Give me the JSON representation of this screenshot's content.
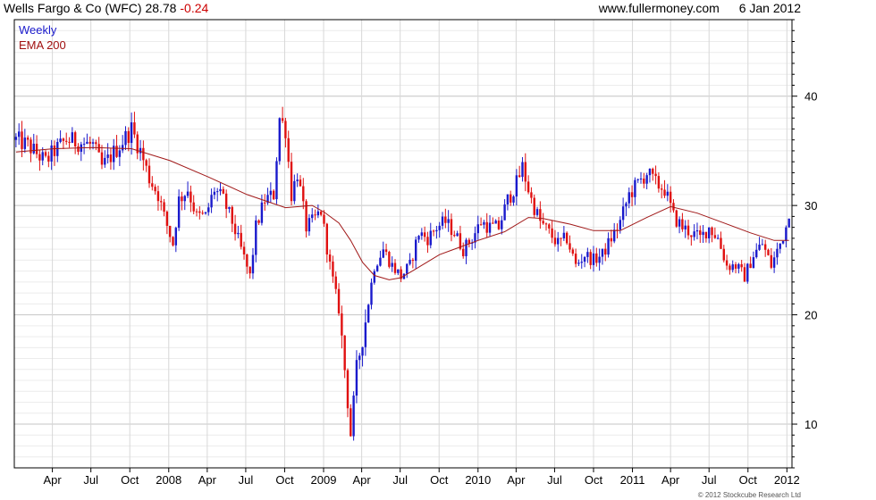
{
  "header": {
    "title": "Wells Fargo & Co (WFC)",
    "last": "28.78",
    "change": "-0.24",
    "site": "www.fullermoney.com",
    "date": "6 Jan 2012"
  },
  "legend": {
    "weekly": "Weekly",
    "ema": "EMA 200"
  },
  "credit": "© 2012 Stockcube Research Ltd",
  "colors": {
    "up": "#1a1acc",
    "down": "#e01010",
    "ema": "#a01818",
    "grid": "#d4d4d4"
  },
  "chart_data": {
    "type": "line",
    "title": "Wells Fargo & Co (WFC)",
    "xlabel": "",
    "ylabel": "",
    "ylim": [
      6,
      47
    ],
    "yticks": [
      "10",
      "20",
      "30",
      "40"
    ],
    "ytick_values": [
      10,
      20,
      30,
      40
    ],
    "xticks": [
      "Apr",
      "Jul",
      "Oct",
      "2008",
      "Apr",
      "Jul",
      "Oct",
      "2009",
      "Apr",
      "Jul",
      "Oct",
      "2010",
      "Apr",
      "Jul",
      "Oct",
      "2011",
      "Apr",
      "Jul",
      "Oct",
      "2012"
    ],
    "xtick_dates": [
      "2007-04-01",
      "2007-07-01",
      "2007-10-01",
      "2008-01-01",
      "2008-04-01",
      "2008-07-01",
      "2008-10-01",
      "2009-01-01",
      "2009-04-01",
      "2009-07-01",
      "2009-10-01",
      "2010-01-01",
      "2010-04-01",
      "2010-07-01",
      "2010-10-01",
      "2011-01-01",
      "2011-04-01",
      "2011-07-01",
      "2011-10-01",
      "2012-01-01"
    ],
    "x_range": [
      "2007-01-01",
      "2012-01-13"
    ],
    "grid": true,
    "legend_position": "top-left",
    "series": [
      {
        "name": "Weekly",
        "kind": "price",
        "points": [
          [
            "2007-01-05",
            36.0
          ],
          [
            "2007-02-02",
            35.5
          ],
          [
            "2007-03-02",
            34.5
          ],
          [
            "2007-03-16",
            34.0
          ],
          [
            "2007-04-06",
            35.0
          ],
          [
            "2007-05-04",
            36.0
          ],
          [
            "2007-06-01",
            35.8
          ],
          [
            "2007-07-06",
            35.5
          ],
          [
            "2007-07-27",
            33.5
          ],
          [
            "2007-08-17",
            34.5
          ],
          [
            "2007-09-07",
            35.5
          ],
          [
            "2007-10-05",
            37.0
          ],
          [
            "2007-10-26",
            35.0
          ],
          [
            "2007-11-16",
            32.5
          ],
          [
            "2007-12-07",
            31.0
          ],
          [
            "2007-12-21",
            29.0
          ],
          [
            "2008-01-11",
            26.5
          ],
          [
            "2008-01-25",
            30.5
          ],
          [
            "2008-02-15",
            31.5
          ],
          [
            "2008-03-07",
            29.0
          ],
          [
            "2008-03-28",
            29.0
          ],
          [
            "2008-04-18",
            31.5
          ],
          [
            "2008-05-09",
            30.5
          ],
          [
            "2008-05-30",
            28.5
          ],
          [
            "2008-06-20",
            26.0
          ],
          [
            "2008-07-11",
            23.5
          ],
          [
            "2008-07-25",
            28.0
          ],
          [
            "2008-08-15",
            30.5
          ],
          [
            "2008-09-05",
            31.0
          ],
          [
            "2008-09-19",
            38.0
          ],
          [
            "2008-10-03",
            37.0
          ],
          [
            "2008-10-17",
            31.0
          ],
          [
            "2008-10-31",
            33.0
          ],
          [
            "2008-11-21",
            28.0
          ],
          [
            "2008-12-05",
            28.5
          ],
          [
            "2008-12-26",
            29.5
          ],
          [
            "2009-01-16",
            24.5
          ],
          [
            "2009-02-06",
            20.5
          ],
          [
            "2009-02-20",
            15.0
          ],
          [
            "2009-03-06",
            9.0
          ],
          [
            "2009-03-20",
            15.0
          ],
          [
            "2009-04-10",
            19.5
          ],
          [
            "2009-05-01",
            24.5
          ],
          [
            "2009-05-22",
            26.0
          ],
          [
            "2009-06-12",
            24.5
          ],
          [
            "2009-07-03",
            23.5
          ],
          [
            "2009-07-24",
            24.5
          ],
          [
            "2009-08-14",
            27.5
          ],
          [
            "2009-09-04",
            27.0
          ],
          [
            "2009-09-25",
            28.0
          ],
          [
            "2009-10-16",
            28.5
          ],
          [
            "2009-11-06",
            27.5
          ],
          [
            "2009-11-27",
            26.0
          ],
          [
            "2009-12-18",
            27.0
          ],
          [
            "2010-01-08",
            28.5
          ],
          [
            "2010-01-29",
            28.0
          ],
          [
            "2010-02-19",
            28.0
          ],
          [
            "2010-03-12",
            30.5
          ],
          [
            "2010-04-02",
            32.0
          ],
          [
            "2010-04-16",
            33.5
          ],
          [
            "2010-05-07",
            30.5
          ],
          [
            "2010-05-28",
            28.5
          ],
          [
            "2010-06-18",
            27.5
          ],
          [
            "2010-07-09",
            26.5
          ],
          [
            "2010-07-30",
            27.0
          ],
          [
            "2010-08-20",
            24.5
          ],
          [
            "2010-09-10",
            25.5
          ],
          [
            "2010-10-01",
            25.0
          ],
          [
            "2010-10-22",
            25.5
          ],
          [
            "2010-11-12",
            27.0
          ],
          [
            "2010-12-03",
            28.5
          ],
          [
            "2010-12-24",
            31.0
          ],
          [
            "2011-01-14",
            32.0
          ],
          [
            "2011-02-04",
            33.0
          ],
          [
            "2011-02-25",
            32.0
          ],
          [
            "2011-03-18",
            31.5
          ],
          [
            "2011-04-08",
            29.0
          ],
          [
            "2011-04-29",
            28.0
          ],
          [
            "2011-05-20",
            27.5
          ],
          [
            "2011-06-10",
            27.0
          ],
          [
            "2011-07-01",
            28.0
          ],
          [
            "2011-07-22",
            27.0
          ],
          [
            "2011-08-12",
            24.5
          ],
          [
            "2011-09-02",
            24.5
          ],
          [
            "2011-09-23",
            23.5
          ],
          [
            "2011-10-14",
            25.5
          ],
          [
            "2011-11-04",
            26.5
          ],
          [
            "2011-11-25",
            24.5
          ],
          [
            "2011-12-16",
            26.5
          ],
          [
            "2012-01-06",
            28.8
          ]
        ]
      },
      {
        "name": "EMA 200",
        "kind": "line",
        "points": [
          [
            "2007-01-05",
            34.9
          ],
          [
            "2007-04-06",
            35.2
          ],
          [
            "2007-07-06",
            35.3
          ],
          [
            "2007-10-05",
            35.2
          ],
          [
            "2008-01-04",
            34.1
          ],
          [
            "2008-04-04",
            32.6
          ],
          [
            "2008-07-04",
            31.0
          ],
          [
            "2008-10-03",
            29.8
          ],
          [
            "2008-12-05",
            30.0
          ],
          [
            "2009-01-02",
            29.4
          ],
          [
            "2009-02-06",
            28.4
          ],
          [
            "2009-03-06",
            26.8
          ],
          [
            "2009-04-03",
            24.8
          ],
          [
            "2009-05-01",
            23.6
          ],
          [
            "2009-06-05",
            23.2
          ],
          [
            "2009-07-03",
            23.4
          ],
          [
            "2009-08-07",
            24.2
          ],
          [
            "2009-10-02",
            25.5
          ],
          [
            "2010-01-01",
            26.8
          ],
          [
            "2010-03-05",
            27.6
          ],
          [
            "2010-04-30",
            28.9
          ],
          [
            "2010-06-04",
            28.8
          ],
          [
            "2010-08-06",
            28.3
          ],
          [
            "2010-10-01",
            27.7
          ],
          [
            "2010-12-03",
            27.7
          ],
          [
            "2011-02-04",
            28.9
          ],
          [
            "2011-04-01",
            29.9
          ],
          [
            "2011-06-03",
            29.3
          ],
          [
            "2011-08-05",
            28.4
          ],
          [
            "2011-10-07",
            27.5
          ],
          [
            "2011-12-02",
            26.8
          ],
          [
            "2012-01-06",
            26.8
          ]
        ]
      }
    ]
  }
}
